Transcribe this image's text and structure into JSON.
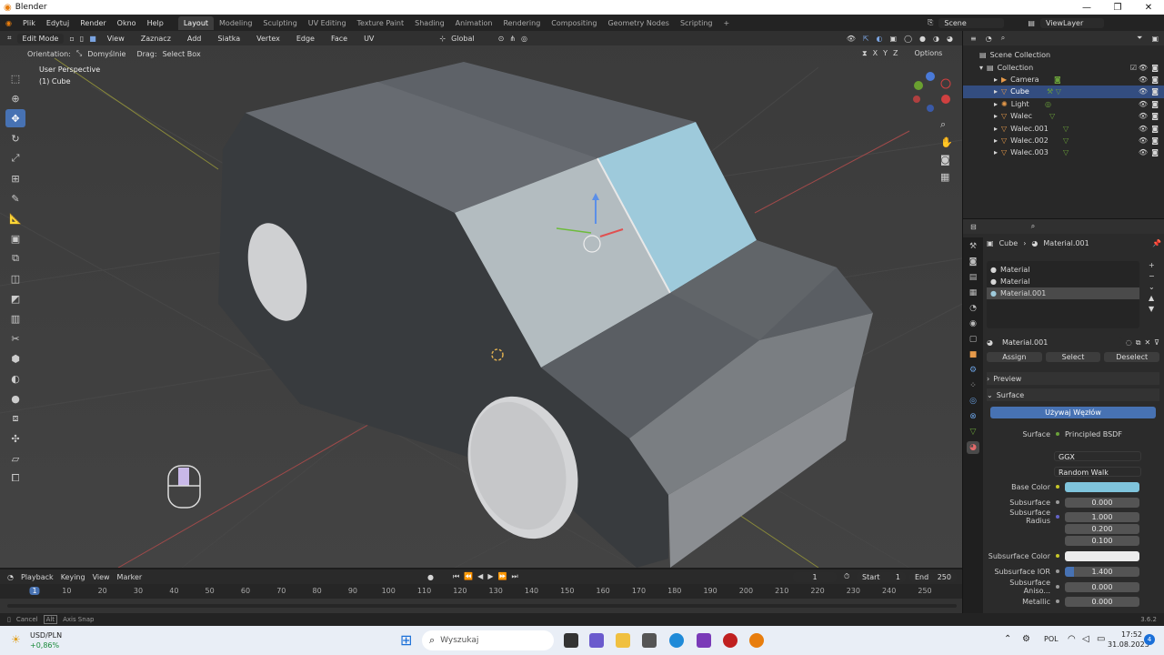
{
  "window": {
    "title": "Blender"
  },
  "menu": [
    "Plik",
    "Edytuj",
    "Render",
    "Okno",
    "Help"
  ],
  "workspaces": [
    "Layout",
    "Modeling",
    "Sculpting",
    "UV Editing",
    "Texture Paint",
    "Shading",
    "Animation",
    "Rendering",
    "Compositing",
    "Geometry Nodes",
    "Scripting"
  ],
  "scene": {
    "name": "Scene",
    "view_layer": "ViewLayer"
  },
  "viewport_header": {
    "mode": "Edit Mode",
    "menus": [
      "View",
      "Zaznacz",
      "Add",
      "Siatka",
      "Vertex",
      "Edge",
      "Face",
      "UV"
    ],
    "transform": "Global",
    "orientation_label": "Orientation:",
    "orientation_value": "Domyślnie",
    "drag_label": "Drag:",
    "drag_value": "Select Box",
    "options": "Options",
    "axes": [
      "X",
      "Y",
      "Z"
    ]
  },
  "viewport_overlay": {
    "perspective": "User Perspective",
    "object": "(1) Cube"
  },
  "outliner": {
    "root": "Scene Collection",
    "collection": "Collection",
    "items": [
      "Camera",
      "Cube",
      "Light",
      "Walec",
      "Walec.001",
      "Walec.002",
      "Walec.003"
    ]
  },
  "properties": {
    "breadcrumb_obj": "Cube",
    "breadcrumb_mat": "Material.001",
    "slots": [
      "Material",
      "Material",
      "Material.001"
    ],
    "material_name": "Material.001",
    "buttons": [
      "Assign",
      "Select",
      "Deselect"
    ],
    "preview": "Preview",
    "surface_panel": "Surface",
    "use_nodes": "Używaj Węzłów",
    "surface_label": "Surface",
    "surface_value": "Principled BSDF",
    "distribution": "GGX",
    "sss_method": "Random Walk",
    "rows": [
      {
        "label": "Base Color",
        "value": ""
      },
      {
        "label": "Subsurface",
        "value": "0.000"
      },
      {
        "label": "Subsurface Radius",
        "value": "1.000"
      },
      {
        "label": "",
        "value": "0.200"
      },
      {
        "label": "",
        "value": "0.100"
      },
      {
        "label": "Subsurface Color",
        "value": ""
      },
      {
        "label": "Subsurface IOR",
        "value": "1.400"
      },
      {
        "label": "Subsurface Aniso...",
        "value": "0.000"
      },
      {
        "label": "Metallic",
        "value": "0.000"
      }
    ],
    "base_color": "#7fc4dc"
  },
  "timeline": {
    "menus": [
      "Playback",
      "Keying",
      "View",
      "Marker"
    ],
    "current_frame": "1",
    "start_label": "Start",
    "start": "1",
    "end_label": "End",
    "end": "250",
    "ticks": [
      "1",
      "10",
      "20",
      "30",
      "40",
      "50",
      "60",
      "70",
      "80",
      "90",
      "100",
      "110",
      "120",
      "130",
      "140",
      "150",
      "160",
      "170",
      "180",
      "190",
      "200",
      "210",
      "220",
      "230",
      "240",
      "250"
    ]
  },
  "statusbar": {
    "left": "Cancel",
    "hint": "Axis Snap",
    "version": "3.6.2"
  },
  "taskbar": {
    "ticker": "USD/PLN",
    "change": "+0,86%",
    "search": "Wyszukaj",
    "lang": "POL",
    "time": "17:52",
    "date": "31.08.2023",
    "badge": "4"
  }
}
